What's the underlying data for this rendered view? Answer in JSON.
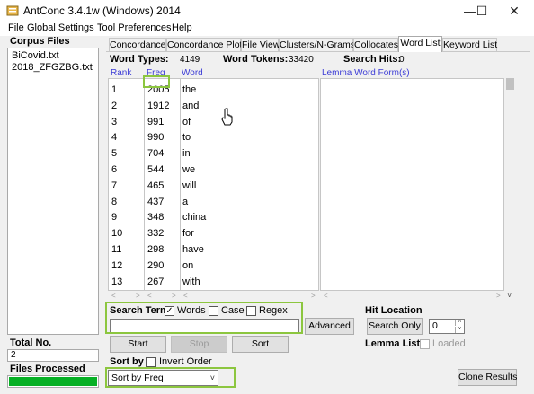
{
  "window": {
    "title": "AntConc 3.4.1w (Windows) 2014",
    "minimize_glyph": "—",
    "maximize_glyph": "☐",
    "close_glyph": "✕"
  },
  "menu": [
    "File",
    "Global Settings",
    "Tool Preferences",
    "Help"
  ],
  "corpus": {
    "label": "Corpus Files",
    "files": [
      "BiCovid.txt",
      "2018_ZFGZBG.txt"
    ],
    "total_label": "Total No.",
    "total_value": "2",
    "processed_label": "Files Processed",
    "progress_fraction": 1.0
  },
  "tabs": [
    "Concordance",
    "Concordance Plot",
    "File View",
    "Clusters/N-Grams",
    "Collocates",
    "Word List",
    "Keyword List"
  ],
  "active_tab": "Word List",
  "stats": {
    "word_types_label": "Word Types:",
    "word_types_value": "4149",
    "word_tokens_label": "Word Tokens:",
    "word_tokens_value": "33420",
    "search_hits_label": "Search Hits:",
    "search_hits_value": "0"
  },
  "columns": {
    "rank": "Rank",
    "freq": "Freq",
    "word": "Word",
    "lemma": "Lemma Word Form(s)"
  },
  "rows": [
    {
      "rank": "1",
      "freq": "2005",
      "word": "the"
    },
    {
      "rank": "2",
      "freq": "1912",
      "word": "and"
    },
    {
      "rank": "3",
      "freq": "991",
      "word": "of"
    },
    {
      "rank": "4",
      "freq": "990",
      "word": "to"
    },
    {
      "rank": "5",
      "freq": "704",
      "word": "in"
    },
    {
      "rank": "6",
      "freq": "544",
      "word": "we"
    },
    {
      "rank": "7",
      "freq": "465",
      "word": "will"
    },
    {
      "rank": "8",
      "freq": "437",
      "word": "a"
    },
    {
      "rank": "9",
      "freq": "348",
      "word": "china"
    },
    {
      "rank": "10",
      "freq": "332",
      "word": "for"
    },
    {
      "rank": "11",
      "freq": "298",
      "word": "have"
    },
    {
      "rank": "12",
      "freq": "290",
      "word": "on"
    },
    {
      "rank": "13",
      "freq": "267",
      "word": "with"
    }
  ],
  "scroll_glyphs": {
    "left": "<",
    "right": ">",
    "up": "˄",
    "down": "˅"
  },
  "search": {
    "term_label": "Search Term",
    "words_label": "Words",
    "words_checked": true,
    "case_label": "Case",
    "case_checked": false,
    "regex_label": "Regex",
    "regex_checked": false,
    "input_value": "",
    "advanced_label": "Advanced",
    "start_label": "Start",
    "stop_label": "Stop",
    "sort_label": "Sort"
  },
  "hit_location": {
    "label": "Hit Location",
    "search_only_label": "Search Only",
    "value": "0"
  },
  "lemma_list": {
    "label": "Lemma List",
    "loaded_label": "Loaded"
  },
  "sort": {
    "label": "Sort by",
    "invert_label": "Invert Order",
    "selected": "Sort by Freq"
  },
  "clone_label": "Clone Results",
  "colors": {
    "highlight": "#8cc63f",
    "header_blue": "#3b3bd6",
    "progress_green": "#06b025"
  }
}
